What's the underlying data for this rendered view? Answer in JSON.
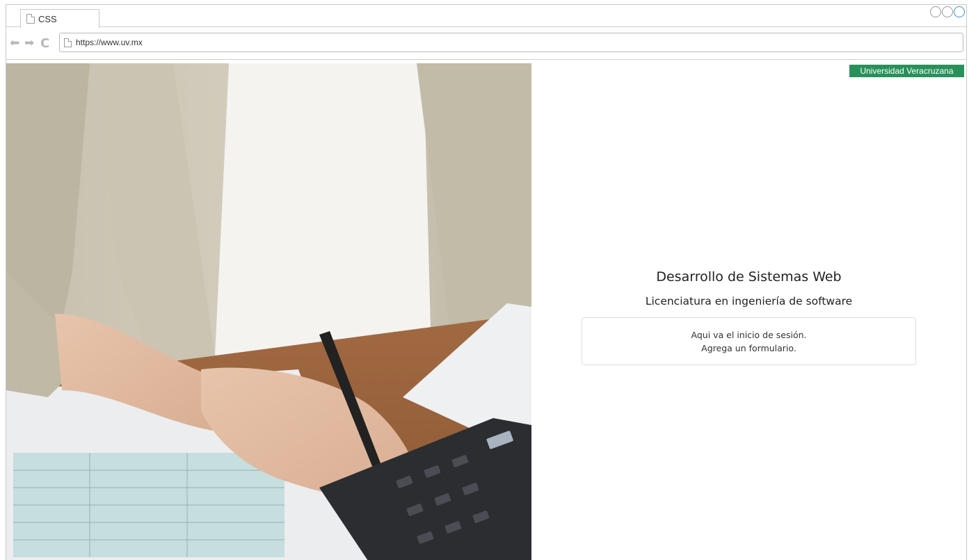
{
  "browser": {
    "tab_title": "CSS",
    "url": "https://www.uv.mx",
    "icons": {
      "back": "back-arrow-icon",
      "forward": "forward-arrow-icon",
      "reload": "reload-icon",
      "page": "document-icon"
    }
  },
  "page": {
    "badge": "Universidad Veracruzana",
    "title": "Desarrollo de Sistemas Web",
    "subtitle": "Licenciatura en ingeniería de software",
    "card_lines": [
      "Aqui va el inicio de sesión.",
      "Agrega un formulario."
    ]
  },
  "colors": {
    "badge_bg": "#28915a",
    "active_control": "#3b8ed8"
  }
}
